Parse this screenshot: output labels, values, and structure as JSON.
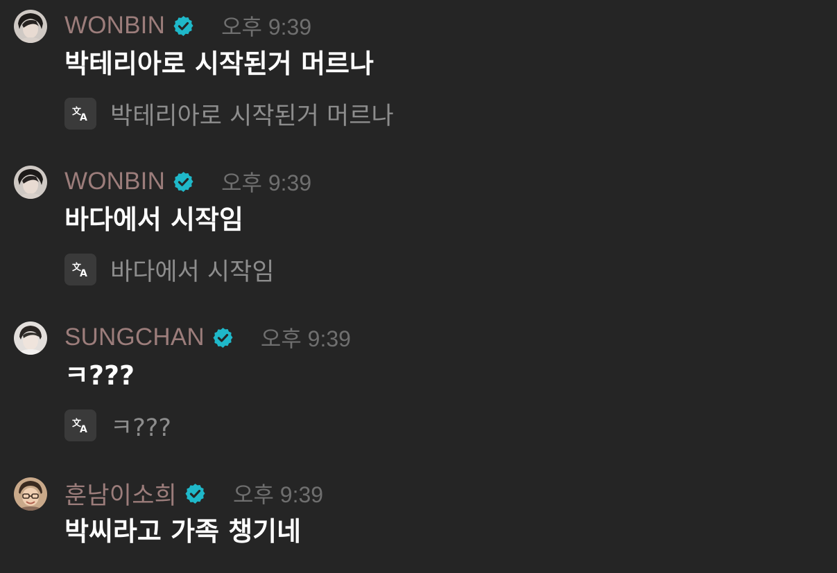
{
  "messages": [
    {
      "author": "WONBIN",
      "time": "오후 9:39",
      "text": "박테리아로 시작된거 머르나",
      "translation": "박테리아로 시작된거 머르나"
    },
    {
      "author": "WONBIN",
      "time": "오후 9:39",
      "text": "바다에서 시작임",
      "translation": "바다에서 시작임"
    },
    {
      "author": "SUNGCHAN",
      "time": "오후 9:39",
      "text": "ㅋ???",
      "translation": "ㅋ???"
    },
    {
      "author": "훈남이소희",
      "time": "오후 9:39",
      "text": "박씨라고 가족 챙기네"
    }
  ],
  "colors": {
    "background": "#252525",
    "author": "#9c7d7b",
    "timestamp": "#6f6f6f",
    "message_text": "#ffffff",
    "translation_text": "#8d8d8d",
    "verified_badge": "#1fb8c9"
  },
  "icons": {
    "verified": "verified-badge-icon",
    "translate": "translate-icon"
  }
}
